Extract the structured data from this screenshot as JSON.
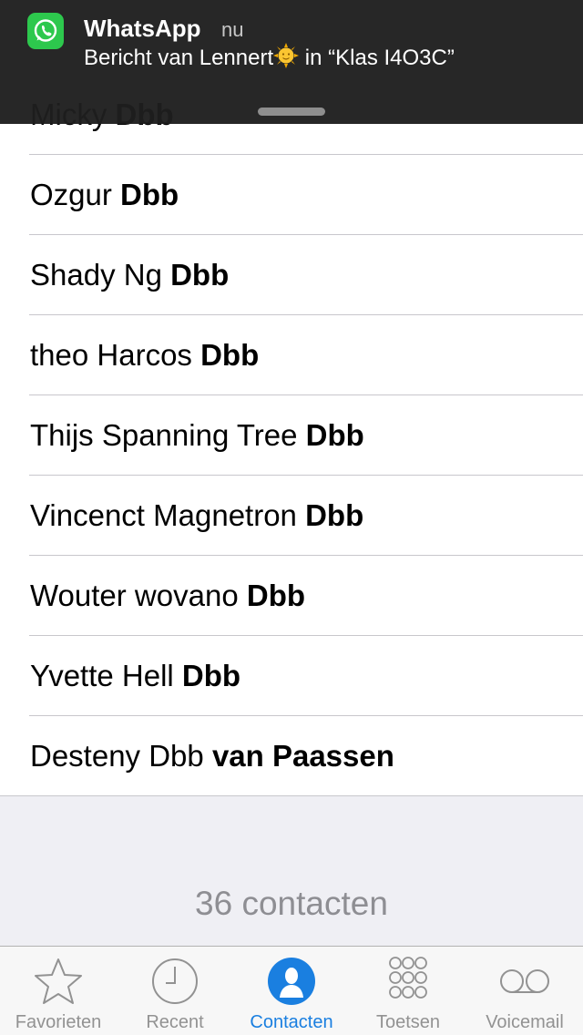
{
  "notification": {
    "app_name": "WhatsApp",
    "time": "nu",
    "message_prefix": "Bericht van Lennert",
    "emoji": "sun-with-face",
    "message_suffix": " in “Klas I4O3C”",
    "app_icon": "whatsapp-icon"
  },
  "contacts": [
    {
      "first": "Micky ",
      "last": "Dbb"
    },
    {
      "first": "Ozgur ",
      "last": "Dbb"
    },
    {
      "first": "Shady Ng ",
      "last": "Dbb"
    },
    {
      "first": "theo Harcos ",
      "last": "Dbb"
    },
    {
      "first": "Thijs Spanning Tree ",
      "last": "Dbb"
    },
    {
      "first": "Vincenct Magnetron ",
      "last": "Dbb"
    },
    {
      "first": "Wouter wovano ",
      "last": "Dbb"
    },
    {
      "first": "Yvette Hell ",
      "last": "Dbb"
    },
    {
      "first": "Desteny Dbb ",
      "last": "van Paassen"
    }
  ],
  "footer": {
    "count_text": "36 contacten"
  },
  "tab_bar": {
    "active_color": "#1a7fe0",
    "inactive_color": "#929292",
    "tabs": [
      {
        "label": "Favorieten",
        "icon": "star-icon"
      },
      {
        "label": "Recent",
        "icon": "clock-icon"
      },
      {
        "label": "Contacten",
        "icon": "person-icon"
      },
      {
        "label": "Toetsen",
        "icon": "keypad-icon"
      },
      {
        "label": "Voicemail",
        "icon": "voicemail-icon"
      }
    ]
  }
}
